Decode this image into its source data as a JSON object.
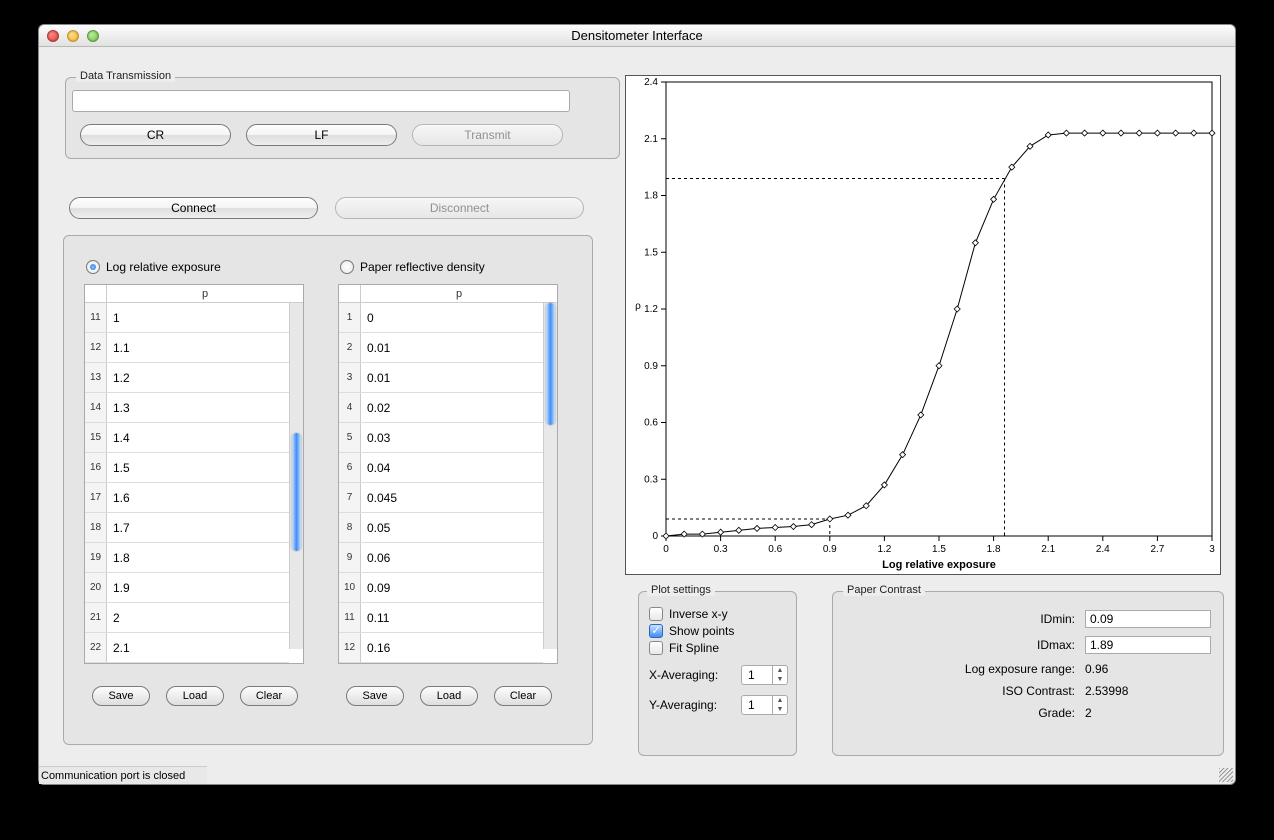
{
  "window": {
    "title": "Densitometer Interface"
  },
  "data_transmission": {
    "legend": "Data Transmission",
    "input_value": "",
    "cr": "CR",
    "lf": "LF",
    "transmit": "Transmit"
  },
  "connection": {
    "connect": "Connect",
    "disconnect": "Disconnect"
  },
  "radios": {
    "log_label": "Log relative exposure",
    "paper_label": "Paper reflective density"
  },
  "column_header": "p",
  "buttons": {
    "save": "Save",
    "load": "Load",
    "clear": "Clear"
  },
  "table_log": {
    "rows": [
      {
        "n": "11",
        "v": "1"
      },
      {
        "n": "12",
        "v": "1.1"
      },
      {
        "n": "13",
        "v": "1.2"
      },
      {
        "n": "14",
        "v": "1.3"
      },
      {
        "n": "15",
        "v": "1.4"
      },
      {
        "n": "16",
        "v": "1.5"
      },
      {
        "n": "17",
        "v": "1.6"
      },
      {
        "n": "18",
        "v": "1.7"
      },
      {
        "n": "19",
        "v": "1.8"
      },
      {
        "n": "20",
        "v": "1.9"
      },
      {
        "n": "21",
        "v": "2"
      },
      {
        "n": "22",
        "v": "2.1"
      }
    ],
    "thumb_top": 130,
    "thumb_height": 118
  },
  "table_paper": {
    "rows": [
      {
        "n": "1",
        "v": "0"
      },
      {
        "n": "2",
        "v": "0.01"
      },
      {
        "n": "3",
        "v": "0.01"
      },
      {
        "n": "4",
        "v": "0.02"
      },
      {
        "n": "5",
        "v": "0.03"
      },
      {
        "n": "6",
        "v": "0.04"
      },
      {
        "n": "7",
        "v": "0.045"
      },
      {
        "n": "8",
        "v": "0.05"
      },
      {
        "n": "9",
        "v": "0.06"
      },
      {
        "n": "10",
        "v": "0.09"
      },
      {
        "n": "11",
        "v": "0.11"
      },
      {
        "n": "12",
        "v": "0.16"
      }
    ],
    "thumb_top": 0,
    "thumb_height": 122
  },
  "plot_settings": {
    "legend": "Plot settings",
    "inverse": "Inverse x-y",
    "show_points": "Show points",
    "fit_spline": "Fit Spline",
    "x_avg_label": "X-Averaging:",
    "y_avg_label": "Y-Averaging:",
    "x_avg_val": "1",
    "y_avg_val": "1",
    "inverse_checked": false,
    "show_points_checked": true,
    "fit_spline_checked": false
  },
  "paper_contrast": {
    "legend": "Paper Contrast",
    "idmin_label": "IDmin:",
    "idmax_label": "IDmax:",
    "idmin": "0.09",
    "idmax": "1.89",
    "ler_label": "Log exposure range:",
    "ler_val": "0.96",
    "iso_label": "ISO Contrast:",
    "iso_val": "2.53998",
    "grade_label": "Grade:",
    "grade_val": "2"
  },
  "status": "Communication port is closed",
  "chart_data": {
    "type": "line",
    "title": "",
    "xlabel": "Log relative exposure",
    "ylabel": "ρ",
    "xlim": [
      0,
      3
    ],
    "ylim": [
      0,
      2.4
    ],
    "x_ticks": [
      0,
      0.3,
      0.6,
      0.9,
      1.2,
      1.5,
      1.8,
      2.1,
      2.4,
      2.7,
      3
    ],
    "y_ticks": [
      0,
      0.3,
      0.6,
      0.9,
      1.2,
      1.5,
      1.8,
      2.1,
      2.4
    ],
    "x": [
      0,
      0.1,
      0.2,
      0.3,
      0.4,
      0.5,
      0.6,
      0.7,
      0.8,
      0.9,
      1.0,
      1.1,
      1.2,
      1.3,
      1.4,
      1.5,
      1.6,
      1.7,
      1.8,
      1.9,
      2.0,
      2.1,
      2.2,
      2.3,
      2.4,
      2.5,
      2.6,
      2.7,
      2.8,
      2.9,
      3.0
    ],
    "y": [
      0,
      0.01,
      0.01,
      0.02,
      0.03,
      0.04,
      0.045,
      0.05,
      0.06,
      0.09,
      0.11,
      0.16,
      0.27,
      0.43,
      0.64,
      0.9,
      1.2,
      1.55,
      1.78,
      1.95,
      2.06,
      2.12,
      2.13,
      2.13,
      2.13,
      2.13,
      2.13,
      2.13,
      2.13,
      2.13,
      2.13
    ],
    "guides": {
      "idmin": 0.09,
      "idmax": 1.89,
      "x_at_idmin": 0.9,
      "x_at_idmax": 1.86
    }
  }
}
